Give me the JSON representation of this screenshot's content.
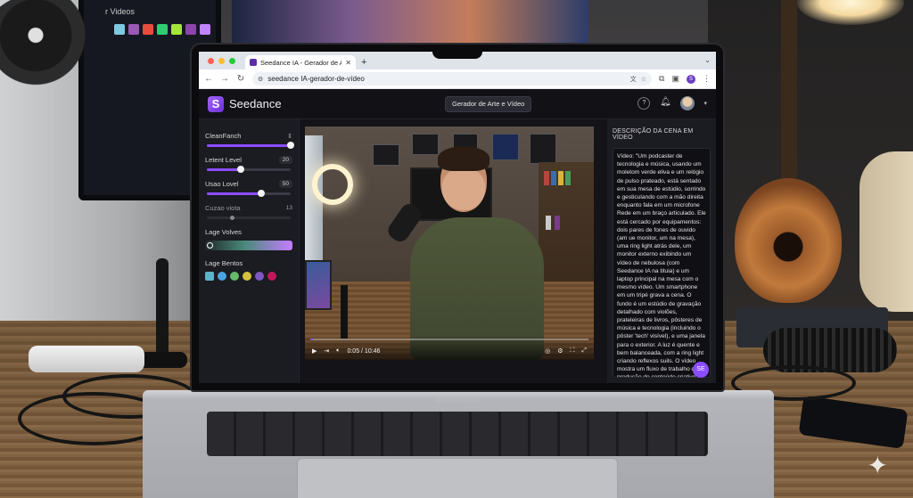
{
  "background": {
    "monitor_title": "r Videos",
    "swatch_colors": [
      "#7ec8e3",
      "#9b59b6",
      "#e74c3c",
      "#2ecc71",
      "#a3e635",
      "#8e44ad",
      "#c084fc"
    ]
  },
  "laptop": {
    "brand": "MacBook Pro"
  },
  "browser": {
    "tab_title": "Seedance IA - Gerador de Arte",
    "url": "seedance IA-gerador-de-vídeo"
  },
  "header": {
    "logo_text": "Seedance",
    "pill_label": "Gerador de Arte e Vídeo"
  },
  "left_panel": {
    "controls": [
      {
        "label": "CleanFanch",
        "value": null,
        "fill": 1.0
      },
      {
        "label": "Letent Level",
        "value": "20",
        "fill": 0.4
      },
      {
        "label": "Usao Lovel",
        "value": "50",
        "fill": 0.65
      },
      {
        "label": "Cuzao viota",
        "value": "13",
        "fill": 0.3
      }
    ],
    "gradient_label": "Lage Volves",
    "swatch_label": "Lage Bentos",
    "swatches": [
      "#5fb3c9",
      "#4aa3df",
      "#66bb6a",
      "#d4c23a",
      "#7e57c2",
      "#c2185b"
    ]
  },
  "video": {
    "time": "0:05 / 10:46",
    "progress": 0.01
  },
  "right_panel": {
    "title": "DESCRIÇÃO DA CENA EM VÍDEO",
    "description": "Vídeo: \"Um podcaster de tecnologia e música, usando um moletom verde eliva e um relógio de pulso prateado, está sentado em sua mesa de estúdio, sorrindo e gesticulando com a mão direita enquanto fala em um microfone Rede em um braço articulado. Ele está cercado por equipamentos: dois pares de fones de ouvido (am ue monitor, um na mesa), uma ring light atrás dele, um monitor externo exibindo um vídeo de nebulosa (com Seedance IA na tituia) e um laptop principal na mesa com o mesmo vídeo. Um smartphone em um tripé grava a cena. O fundo é um estúdio de gravação detalhado com violões, prateleiras de livros, pôsteres de música e tecnologia (incluindo o pôster 'tech' visível), e uma janela para o exterior. A luz é quente e bem balanceada, com a ring light criando reflexos suils. O vídeo mostra um fluxo de trabalho de produção de conteúdo criativo. A câmera está em um ângulo médio fixo\".",
    "fab_label": "SE"
  }
}
